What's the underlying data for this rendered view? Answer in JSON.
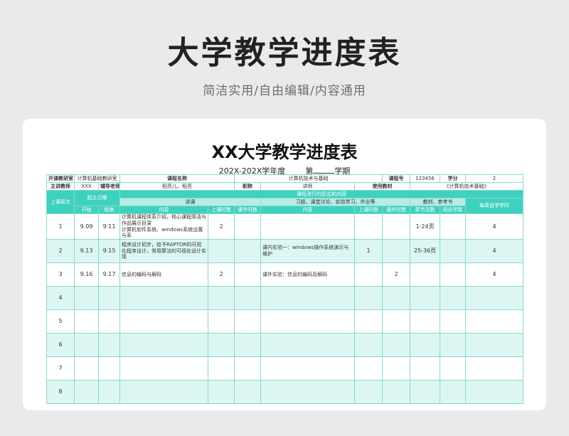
{
  "page": {
    "main_title": "大学教学进度表",
    "subtitle": "简洁实用/自由编辑/内容通用"
  },
  "sheet": {
    "title": "XX大学教学进度表",
    "term_year": "202X-202X学年度",
    "term_di": "第",
    "term_xueqi": "学期"
  },
  "info": {
    "row1": {
      "dept_label": "开课教研室",
      "dept": "计算机基础教研室",
      "course_label": "课程名称",
      "course": "计算机技术与基础",
      "code_label": "课程号",
      "code": "123456",
      "credit_label": "学分",
      "credit": "2"
    },
    "row2": {
      "teacher_label": "主讲教师",
      "teacher": "XXX",
      "assistant_label": "辅导老师",
      "assistant": "稻亮儿，稻亮",
      "title_label": "职称",
      "title": "讲师",
      "textbook_label": "使用教材",
      "textbook": "《计算机技术基础》"
    }
  },
  "headers": {
    "week": "上课周次",
    "date": "起止日期",
    "form": "课程进行的形式和内容",
    "lecture": "讲课",
    "practice": "习题、课堂讨论、实验学习、作业等",
    "material": "教材、参考书",
    "self_hours": "每周自学学时",
    "start": "开始",
    "end": "结束",
    "content": "内容",
    "class_hours": "上课时数",
    "extra_hours": "课外时数",
    "content2": "内容",
    "class_hours2": "上课时数",
    "extra_hours2": "课外时数",
    "pages": "章节页数",
    "self_study": "周自学数"
  },
  "rows": [
    {
      "week": "1",
      "start": "9.09",
      "end": "9.11",
      "lecture": "计算机课程体系介绍，核心课程简洁与作品展示目录\n计算机软件系统、windows系统设置与系",
      "lec_hours": "2",
      "lec_extra": "",
      "practice": "",
      "prac_hours": "",
      "prac_extra": "",
      "pages": "1-24页",
      "self_study": "",
      "self_hours": "4"
    },
    {
      "week": "2",
      "start": "9.13",
      "end": "9.15",
      "lecture": "程序设计初步，给予RAPTOR的可视化程序设计，常用算法的可视化设计实现",
      "lec_hours": "",
      "lec_extra": "",
      "practice": "课内实验一：windows操作系统演示与维护",
      "prac_hours": "1",
      "prac_extra": "",
      "pages": "25-36页",
      "self_study": "",
      "self_hours": "4"
    },
    {
      "week": "3",
      "start": "9.16",
      "end": "9.17",
      "lecture": "信息的编码与解码",
      "lec_hours": "2",
      "lec_extra": "",
      "practice": "课外实验：信息的编码及解码",
      "prac_hours": "",
      "prac_extra": "2",
      "pages": "",
      "self_study": "",
      "self_hours": "4"
    },
    {
      "week": "4",
      "start": "",
      "end": "",
      "lecture": "",
      "lec_hours": "",
      "lec_extra": "",
      "practice": "",
      "prac_hours": "",
      "prac_extra": "",
      "pages": "",
      "self_study": "",
      "self_hours": ""
    },
    {
      "week": "5",
      "start": "",
      "end": "",
      "lecture": "",
      "lec_hours": "",
      "lec_extra": "",
      "practice": "",
      "prac_hours": "",
      "prac_extra": "",
      "pages": "",
      "self_study": "",
      "self_hours": ""
    },
    {
      "week": "6",
      "start": "",
      "end": "",
      "lecture": "",
      "lec_hours": "",
      "lec_extra": "",
      "practice": "",
      "prac_hours": "",
      "prac_extra": "",
      "pages": "",
      "self_study": "",
      "self_hours": ""
    },
    {
      "week": "7",
      "start": "",
      "end": "",
      "lecture": "",
      "lec_hours": "",
      "lec_extra": "",
      "practice": "",
      "prac_hours": "",
      "prac_extra": "",
      "pages": "",
      "self_study": "",
      "self_hours": ""
    },
    {
      "week": "8",
      "start": "",
      "end": "",
      "lecture": "",
      "lec_hours": "",
      "lec_extra": "",
      "practice": "",
      "prac_hours": "",
      "prac_extra": "",
      "pages": "",
      "self_study": "",
      "self_hours": ""
    }
  ],
  "colors": {
    "accent": "#3fd1bf",
    "light": "#dcf7f3",
    "sub": "#b5ece4"
  }
}
